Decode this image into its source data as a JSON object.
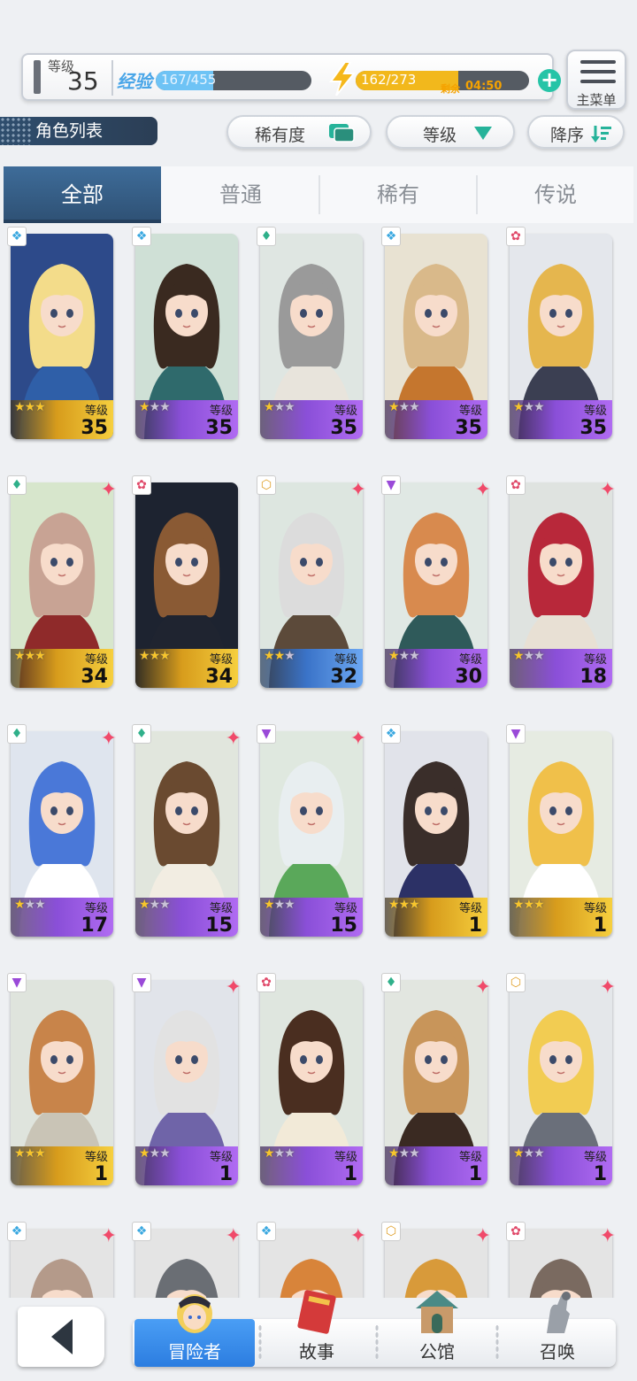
{
  "status": {
    "level_label": "等级",
    "level_value": "35",
    "exp_label": "经验",
    "exp_text": "167/455",
    "exp_progress": 0.367,
    "stamina_text": "162/273",
    "stamina_progress": 0.593,
    "stamina_timer_label": "剩余",
    "stamina_timer": "04:50",
    "plus_label": "+"
  },
  "menu": {
    "label": "主菜单"
  },
  "page_title": "角色列表",
  "filters": {
    "rarity_label": "稀有度",
    "level_label": "等级",
    "order_label": "降序"
  },
  "tabs": [
    {
      "label": "全部",
      "active": true
    },
    {
      "label": "普通",
      "active": false
    },
    {
      "label": "稀有",
      "active": false
    },
    {
      "label": "传说",
      "active": false
    }
  ],
  "level_label": "等级",
  "cards": [
    {
      "level": "35",
      "stars": 3,
      "tier": "gold",
      "element": "water",
      "hair": "#f3dc8a",
      "outfit": "#2f5fa8",
      "bg": "#2d4a8a",
      "spark": false
    },
    {
      "level": "35",
      "stars": 1,
      "tier": "purple",
      "element": "water",
      "hair": "#3a2a20",
      "outfit": "#2f6a6c",
      "bg": "#cfe0d6",
      "spark": false
    },
    {
      "level": "35",
      "stars": 1,
      "tier": "purple",
      "element": "wind",
      "hair": "#9a9a9a",
      "outfit": "#e8e4dc",
      "bg": "#dfe6e2",
      "spark": false
    },
    {
      "level": "35",
      "stars": 1,
      "tier": "purple",
      "element": "water",
      "hair": "#d9b98a",
      "outfit": "#c5762e",
      "bg": "#e8e2d2",
      "spark": false
    },
    {
      "level": "35",
      "stars": 1,
      "tier": "purple",
      "element": "fire",
      "hair": "#e5b64e",
      "outfit": "#3b3f52",
      "bg": "#e4e7ec",
      "spark": false
    },
    {
      "level": "34",
      "stars": 3,
      "tier": "gold",
      "element": "wind",
      "hair": "#c8a394",
      "outfit": "#8f2a2a",
      "bg": "#d7e6cc",
      "spark": true
    },
    {
      "level": "34",
      "stars": 3,
      "tier": "gold",
      "element": "fire",
      "hair": "#8a5a34",
      "outfit": "#1f2430",
      "bg": "#1d2330",
      "spark": false
    },
    {
      "level": "32",
      "stars": 2,
      "tier": "blue",
      "element": "earth",
      "hair": "#dcdcdc",
      "outfit": "#5c4a3a",
      "bg": "#dde6e0",
      "spark": true
    },
    {
      "level": "30",
      "stars": 1,
      "tier": "purple",
      "element": "dark",
      "hair": "#d88a4e",
      "outfit": "#2f5a5a",
      "bg": "#e0e8e4",
      "spark": true
    },
    {
      "level": "18",
      "stars": 1,
      "tier": "purple",
      "element": "fire",
      "hair": "#b8283a",
      "outfit": "#e8e0d4",
      "bg": "#dfe3e0",
      "spark": true
    },
    {
      "level": "17",
      "stars": 1,
      "tier": "purple",
      "element": "wind",
      "hair": "#4a78d8",
      "outfit": "#ffffff",
      "bg": "#dfe5ee",
      "spark": true
    },
    {
      "level": "15",
      "stars": 1,
      "tier": "purple",
      "element": "wind",
      "hair": "#6a4a30",
      "outfit": "#f2ede2",
      "bg": "#e1e6dd",
      "spark": true
    },
    {
      "level": "15",
      "stars": 1,
      "tier": "purple",
      "element": "dark",
      "hair": "#e8eef0",
      "outfit": "#5aa85a",
      "bg": "#dfe8df",
      "spark": true
    },
    {
      "level": "1",
      "stars": 3,
      "tier": "gold",
      "element": "water",
      "hair": "#3a2e2a",
      "outfit": "#2c3166",
      "bg": "#e1e3ea",
      "spark": false
    },
    {
      "level": "1",
      "stars": 3,
      "tier": "gold",
      "element": "dark",
      "hair": "#f0c04a",
      "outfit": "#ffffff",
      "bg": "#e6ebe2",
      "spark": false
    },
    {
      "level": "1",
      "stars": 3,
      "tier": "gold",
      "element": "dark",
      "hair": "#c8844a",
      "outfit": "#c9c4b6",
      "bg": "#dfe4dd",
      "spark": false
    },
    {
      "level": "1",
      "stars": 1,
      "tier": "purple",
      "element": "dark",
      "hair": "#e2e2e2",
      "outfit": "#6f64a8",
      "bg": "#e1e4ea",
      "spark": true
    },
    {
      "level": "1",
      "stars": 1,
      "tier": "purple",
      "element": "fire",
      "hair": "#4a2e20",
      "outfit": "#f2ead8",
      "bg": "#dfe6df",
      "spark": false
    },
    {
      "level": "1",
      "stars": 1,
      "tier": "purple",
      "element": "wind",
      "hair": "#c8955a",
      "outfit": "#3a2a22",
      "bg": "#e2e6e0",
      "spark": true
    },
    {
      "level": "1",
      "stars": 1,
      "tier": "purple",
      "element": "earth",
      "hair": "#f2cc52",
      "outfit": "#6a6f7a",
      "bg": "#e4e7ea",
      "spark": true
    },
    {
      "level": "",
      "stars": 0,
      "tier": "none",
      "element": "water",
      "hair": "#b49a8a",
      "outfit": "#d8c8c0",
      "bg": "#e4e4e4",
      "spark": true
    },
    {
      "level": "",
      "stars": 0,
      "tier": "none",
      "element": "water",
      "hair": "#6a6e74",
      "outfit": "#cfd3d8",
      "bg": "#e4e4e4",
      "spark": true
    },
    {
      "level": "",
      "stars": 0,
      "tier": "none",
      "element": "water",
      "hair": "#d8843a",
      "outfit": "#e0d8d0",
      "bg": "#e4e4e4",
      "spark": true
    },
    {
      "level": "",
      "stars": 0,
      "tier": "none",
      "element": "earth",
      "hair": "#d89a3a",
      "outfit": "#e8d8c0",
      "bg": "#e4e4e4",
      "spark": true
    },
    {
      "level": "",
      "stars": 0,
      "tier": "none",
      "element": "fire",
      "hair": "#7a6a60",
      "outfit": "#d8d0c8",
      "bg": "#e4e4e4",
      "spark": true
    }
  ],
  "element_icons": {
    "water": {
      "glyph": "❖",
      "color": "#3aa8e0"
    },
    "wind": {
      "glyph": "♦",
      "color": "#2fb08a"
    },
    "fire": {
      "glyph": "✿",
      "color": "#e04a6a"
    },
    "earth": {
      "glyph": "⬡",
      "color": "#e0a02a"
    },
    "dark": {
      "glyph": "▼",
      "color": "#9a4ad8"
    }
  },
  "bottom_nav": {
    "items": [
      {
        "label": "冒险者",
        "active": true
      },
      {
        "label": "故事",
        "active": false
      },
      {
        "label": "公馆",
        "active": false
      },
      {
        "label": "召唤",
        "active": false
      }
    ]
  }
}
